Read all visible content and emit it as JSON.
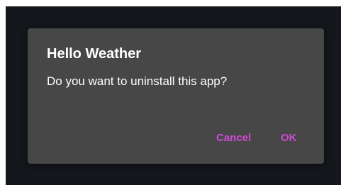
{
  "colors": {
    "background": "#14171b",
    "dialog_background": "#474747",
    "text": "#ffffff",
    "accent": "#d14ad4"
  },
  "dialog": {
    "title": "Hello Weather",
    "message": "Do you want to uninstall this app?",
    "cancel_label": "Cancel",
    "ok_label": "OK"
  }
}
